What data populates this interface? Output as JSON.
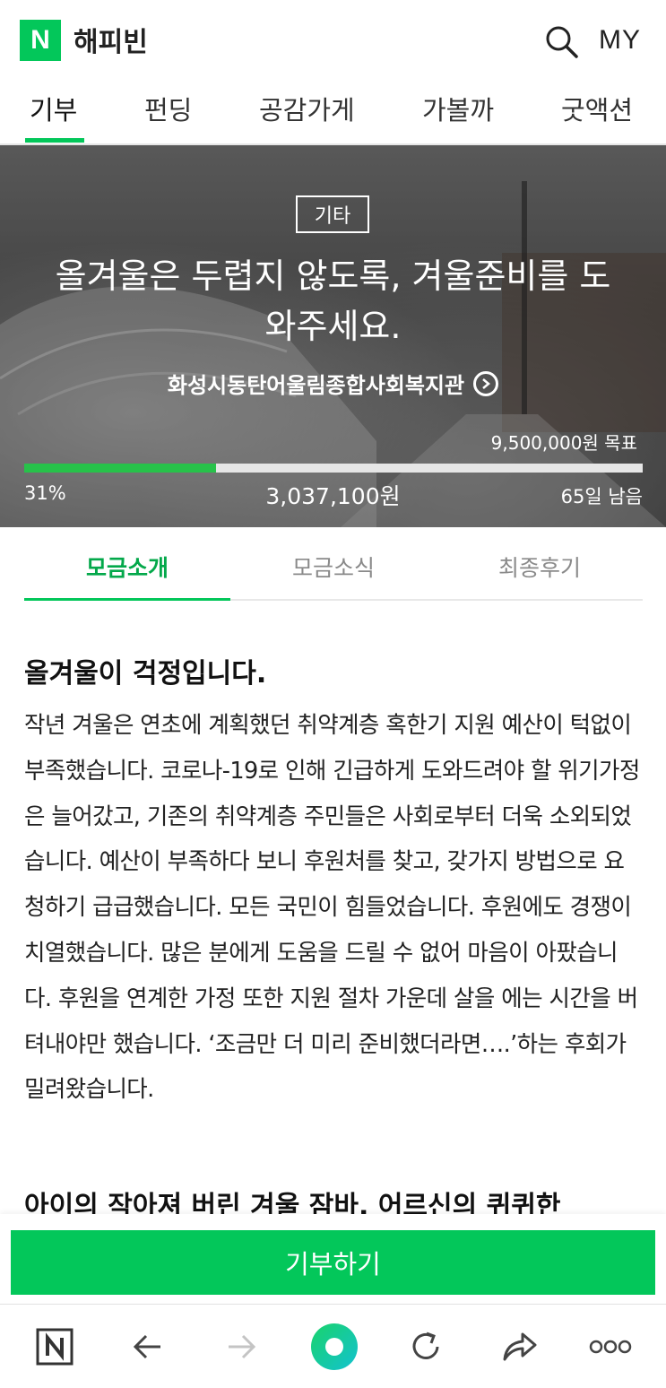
{
  "header": {
    "logo_letter": "N",
    "brand": "해피빈",
    "search_icon": "search-icon",
    "my_label": "MY"
  },
  "category_tabs": [
    {
      "label": "기부",
      "active": true
    },
    {
      "label": "펀딩",
      "active": false
    },
    {
      "label": "공감가게",
      "active": false
    },
    {
      "label": "가볼까",
      "active": false
    },
    {
      "label": "굿액션",
      "active": false
    }
  ],
  "hero": {
    "category_badge": "기타",
    "title": "올겨울은 두렵지 않도록, 겨울준비를 도와주세요.",
    "organization": "화성시동탄어울림종합사회복지관",
    "goal": "9,500,000원 목표",
    "progress_percent": 31,
    "percent_label": "31%",
    "amount_raised": "3,037,100원",
    "days_left": "65일 남음"
  },
  "content_tabs": [
    {
      "label": "모금소개",
      "active": true
    },
    {
      "label": "모금소식",
      "active": false
    },
    {
      "label": "최종후기",
      "active": false
    }
  ],
  "article": {
    "heading": "올겨울이 걱정입니다.",
    "body": "작년 겨울은 연초에 계획했던 취약계층 혹한기 지원 예산이 턱없이 부족했습니다. 코로나-19로 인해 긴급하게 도와드려야 할 위기가정은 늘어갔고, 기존의 취약계층 주민들은 사회로부터 더욱 소외되었습니다. 예산이 부족하다 보니 후원처를 찾고, 갖가지 방법으로 요청하기 급급했습니다. 모든 국민이 힘들었습니다. 후원에도 경쟁이 치열했습니다. 많은 분에게 도움을 드릴 수 없어 마음이 아팠습니다. 후원을 연계한 가정 또한 지원 절차 가운데 살을 에는 시간을 버텨내야만 했습니다. ‘조금만 더 미리 준비했더라면….’하는 후회가 밀려왔습니다.",
    "next_heading_partial": "아이의 작아져 버린 겨울 잠바, 어르신의 퀴퀴한"
  },
  "donate_button": "기부하기",
  "colors": {
    "accent": "#03c75a",
    "progress": "#27c24a",
    "active_tab_text": "#03a84a"
  },
  "bottom_nav": [
    {
      "icon": "naver-home-icon"
    },
    {
      "icon": "back-arrow-icon"
    },
    {
      "icon": "forward-arrow-icon"
    },
    {
      "icon": "green-dot-icon"
    },
    {
      "icon": "refresh-icon"
    },
    {
      "icon": "share-icon"
    },
    {
      "icon": "more-icon"
    }
  ]
}
